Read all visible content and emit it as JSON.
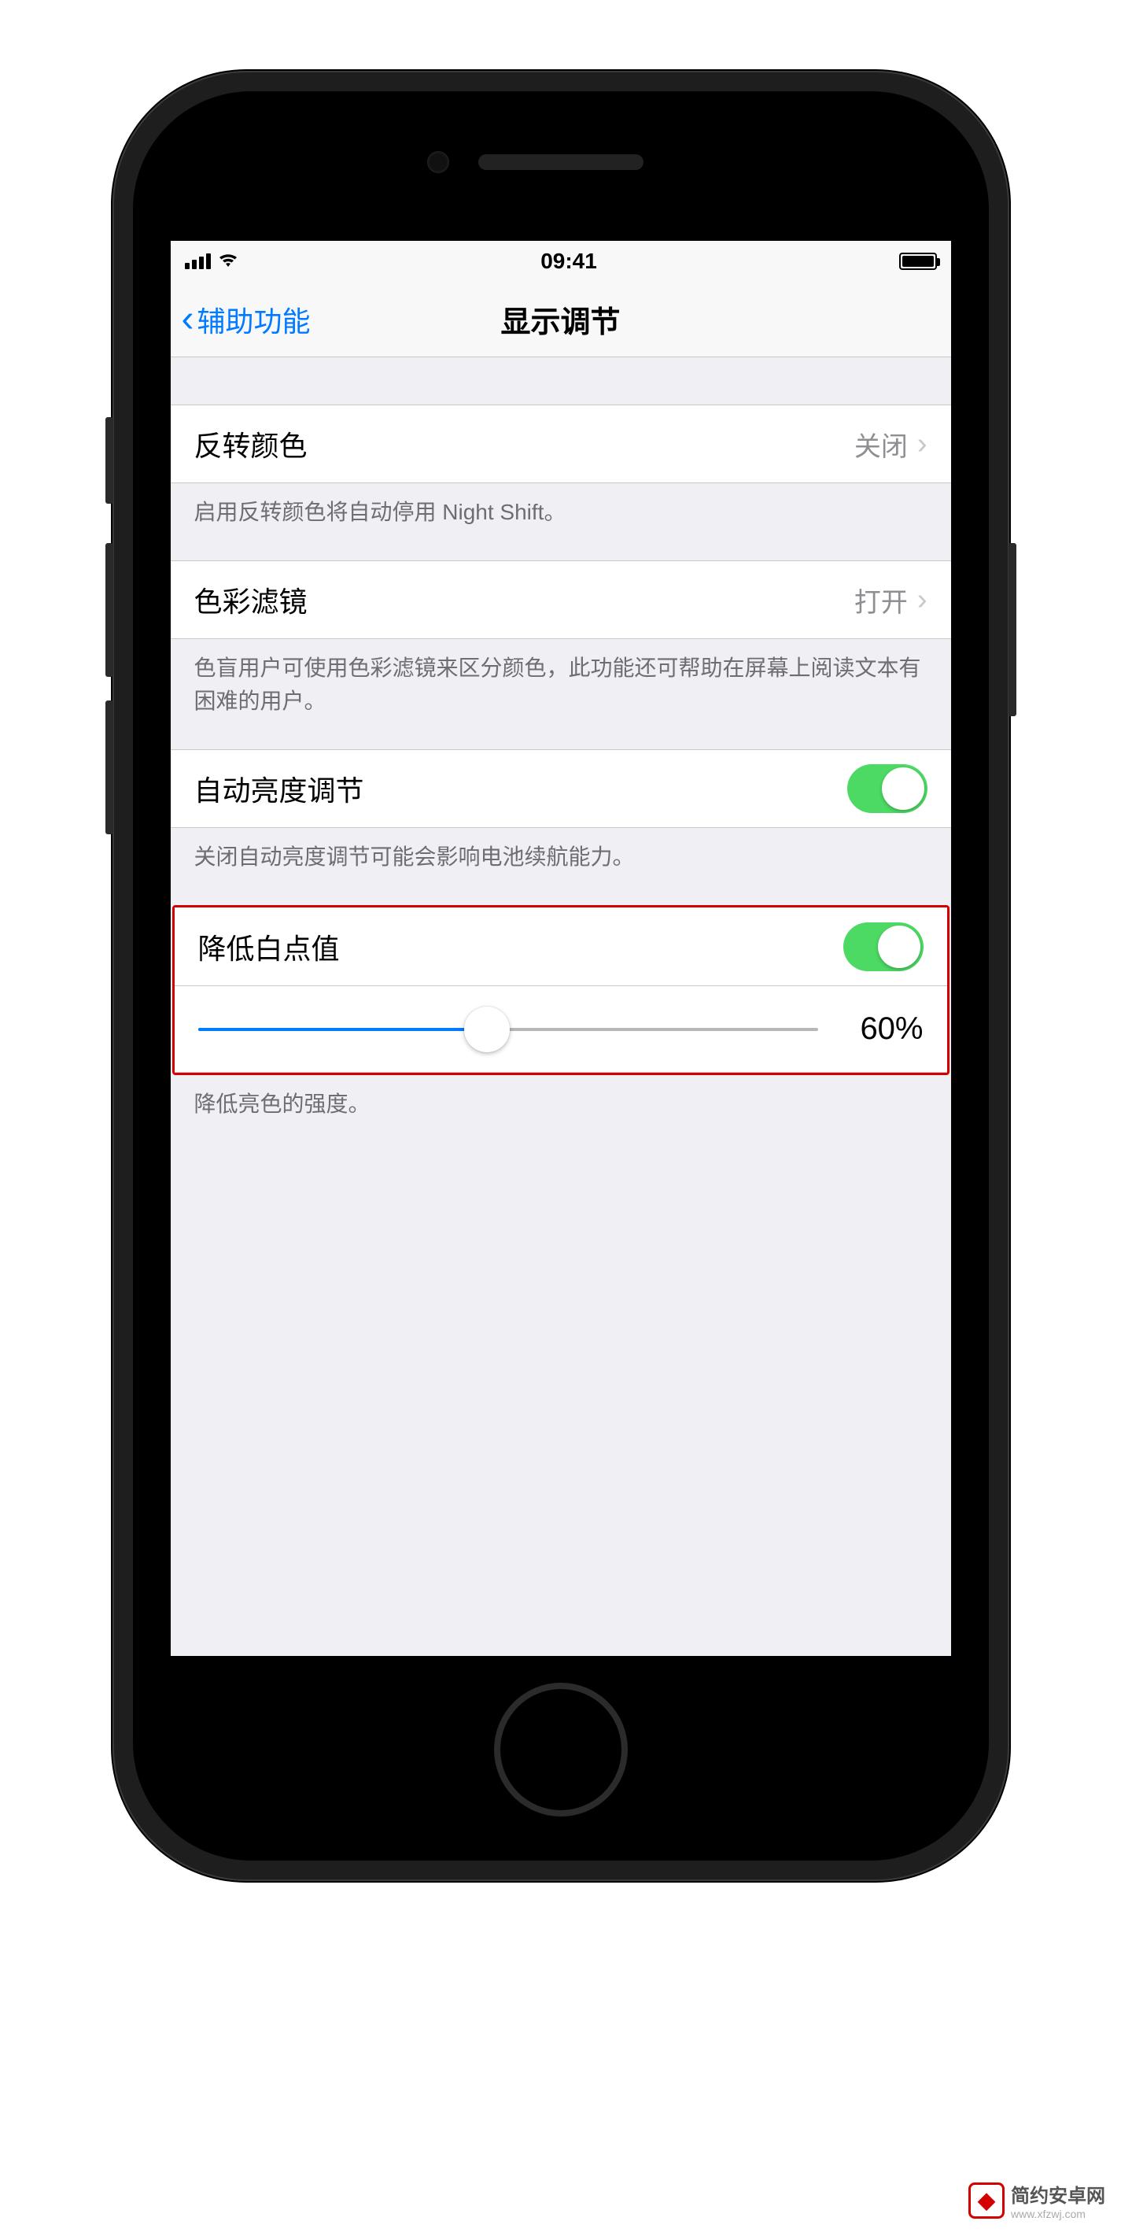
{
  "status": {
    "time": "09:41"
  },
  "nav": {
    "back_label": "辅助功能",
    "title": "显示调节"
  },
  "rows": {
    "invert": {
      "label": "反转颜色",
      "value": "关闭",
      "footer": "启用反转颜色将自动停用 Night Shift。"
    },
    "filter": {
      "label": "色彩滤镜",
      "value": "打开",
      "footer": "色盲用户可使用色彩滤镜来区分颜色，此功能还可帮助在屏幕上阅读文本有困难的用户。"
    },
    "autobright": {
      "label": "自动亮度调节",
      "on": true,
      "footer": "关闭自动亮度调节可能会影响电池续航能力。"
    },
    "whitepoint": {
      "label": "降低白点值",
      "on": true,
      "slider": 60,
      "value_text": "60%",
      "footer": "降低亮色的强度。"
    }
  },
  "watermark": {
    "text": "简约安卓网",
    "sub": "www.xfzwj.com"
  }
}
